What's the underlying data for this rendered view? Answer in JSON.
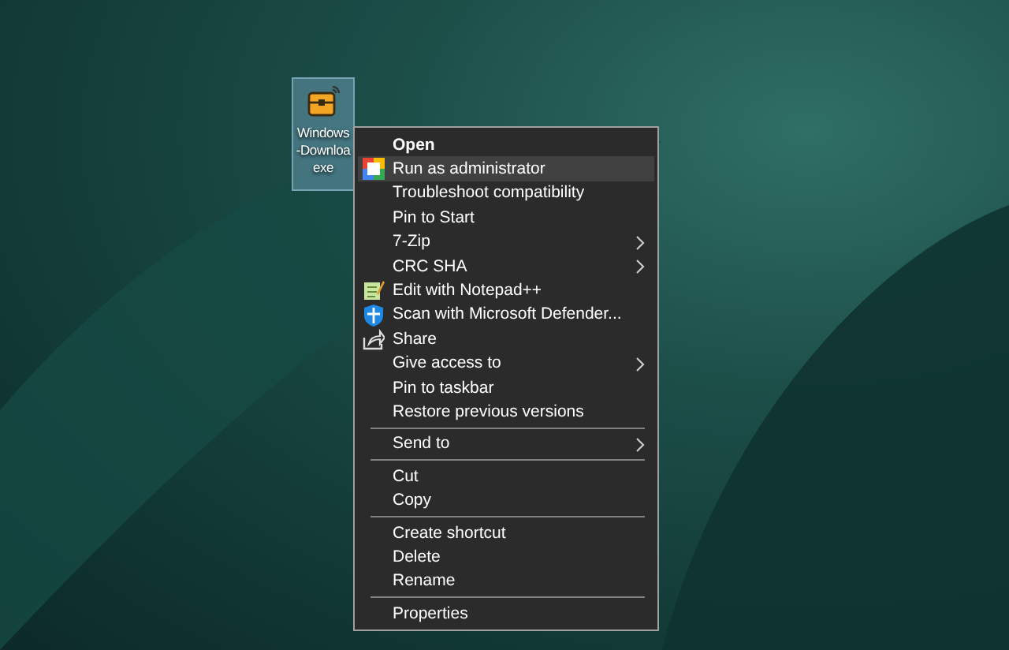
{
  "desktop_icon": {
    "label_lines": [
      "Windows",
      "-Downloa",
      "exe"
    ],
    "selected": true
  },
  "context_menu": {
    "sections": [
      {
        "items": [
          {
            "label": "Open",
            "default": true,
            "selected": false,
            "submenu": false
          },
          {
            "label": "Run as administrator",
            "default": false,
            "selected": true,
            "submenu": false,
            "kind": "squares"
          },
          {
            "label": "Troubleshoot compatibility",
            "default": false,
            "selected": false,
            "submenu": false
          },
          {
            "label": "Pin to Start",
            "default": false,
            "selected": false,
            "submenu": false
          },
          {
            "label": "7-Zip",
            "default": false,
            "selected": false,
            "submenu": true
          },
          {
            "label": "CRC SHA",
            "default": false,
            "selected": false,
            "submenu": true
          },
          {
            "label": "Edit with Notepad++",
            "default": false,
            "selected": false,
            "submenu": false,
            "kind": "notepad"
          },
          {
            "label": "Scan with Microsoft Defender...",
            "default": false,
            "selected": false,
            "submenu": false,
            "kind": "shield"
          },
          {
            "label": "Share",
            "default": false,
            "selected": false,
            "submenu": false,
            "kind": "share"
          },
          {
            "label": "Give access to",
            "default": false,
            "selected": false,
            "submenu": true
          },
          {
            "label": "Pin to taskbar",
            "default": false,
            "selected": false,
            "submenu": false
          },
          {
            "label": "Restore previous versions",
            "default": false,
            "selected": false,
            "submenu": false
          }
        ]
      },
      {
        "items": [
          {
            "label": "Send to",
            "default": false,
            "selected": false,
            "submenu": true
          }
        ]
      },
      {
        "items": [
          {
            "label": "Cut",
            "default": false,
            "selected": false,
            "submenu": false
          },
          {
            "label": "Copy",
            "default": false,
            "selected": false,
            "submenu": false
          }
        ]
      },
      {
        "items": [
          {
            "label": "Create shortcut",
            "default": false,
            "selected": false,
            "submenu": false
          },
          {
            "label": "Delete",
            "default": false,
            "selected": false,
            "submenu": false
          },
          {
            "label": "Rename",
            "default": false,
            "selected": false,
            "submenu": false
          }
        ]
      },
      {
        "items": [
          {
            "label": "Properties",
            "default": false,
            "selected": false,
            "submenu": false
          }
        ]
      }
    ]
  }
}
